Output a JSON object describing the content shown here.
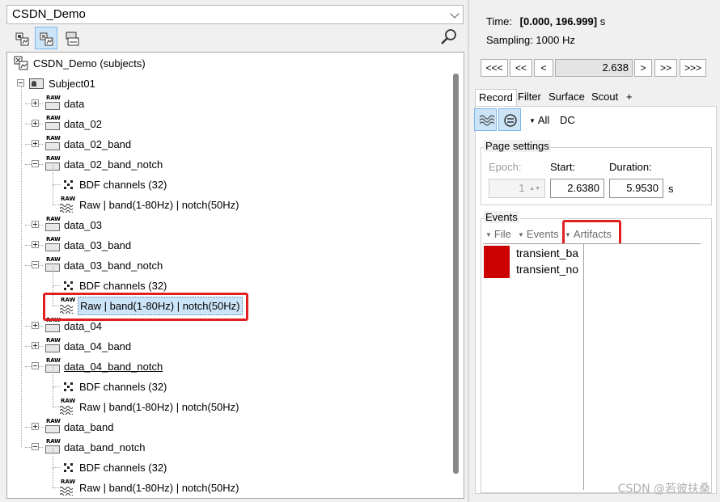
{
  "protocol": {
    "selected": "CSDN_Demo"
  },
  "toolbar": {
    "icons": [
      "view-functional-icon",
      "view-subjects-icon",
      "view-conditions-icon",
      "search-icon"
    ]
  },
  "tree": {
    "root": "CSDN_Demo (subjects)",
    "subject": "Subject01",
    "rows": [
      {
        "label": "data",
        "kind": "folder",
        "expanded": false
      },
      {
        "label": "data_02",
        "kind": "folder",
        "expanded": false
      },
      {
        "label": "data_02_band",
        "kind": "folder",
        "expanded": false
      },
      {
        "label": "data_02_band_notch",
        "kind": "folder",
        "expanded": true
      },
      {
        "label": "BDF channels (32)",
        "kind": "channels"
      },
      {
        "label": "Raw | band(1-80Hz) | notch(50Hz)",
        "kind": "raw"
      },
      {
        "label": "data_03",
        "kind": "folder",
        "expanded": false
      },
      {
        "label": "data_03_band",
        "kind": "folder",
        "expanded": false
      },
      {
        "label": "data_03_band_notch",
        "kind": "folder",
        "expanded": true
      },
      {
        "label": "BDF channels (32)",
        "kind": "channels"
      },
      {
        "label": "Raw | band(1-80Hz) | notch(50Hz)",
        "kind": "raw",
        "selected": true
      },
      {
        "label": "data_04",
        "kind": "folder",
        "expanded": false
      },
      {
        "label": "data_04_band",
        "kind": "folder",
        "expanded": false
      },
      {
        "label": "data_04_band_notch",
        "kind": "folder",
        "expanded": true,
        "underlined": true
      },
      {
        "label": "BDF channels (32)",
        "kind": "channels"
      },
      {
        "label": "Raw | band(1-80Hz) | notch(50Hz)",
        "kind": "raw"
      },
      {
        "label": "data_band",
        "kind": "folder",
        "expanded": false
      },
      {
        "label": "data_band_notch",
        "kind": "folder",
        "expanded": true
      },
      {
        "label": "BDF channels (32)",
        "kind": "channels"
      },
      {
        "label": "Raw | band(1-80Hz) | notch(50Hz)",
        "kind": "raw"
      }
    ]
  },
  "info": {
    "time_label": "Time:",
    "time_value": "[0.000, 196.999]",
    "time_unit": "s",
    "sampling": "Sampling: 1000 Hz"
  },
  "nav": {
    "buttons": [
      "<<<",
      "<<",
      "<",
      ">",
      ">>",
      ">>>"
    ],
    "current_time": "2.638"
  },
  "tabs": [
    "Record",
    "Filter",
    "Surface",
    "Scout",
    "+"
  ],
  "record": {
    "montage_all": "All",
    "montage_dc": "DC",
    "page_settings": {
      "title": "Page settings",
      "epoch_label": "Epoch:",
      "epoch_value": "1",
      "start_label": "Start:",
      "start_value": "2.6380",
      "duration_label": "Duration:",
      "duration_value": "5.9530",
      "unit": "s"
    },
    "events": {
      "title": "Events",
      "menus": [
        "File",
        "Events",
        "Artifacts"
      ],
      "items": [
        "transient_ba",
        "transient_no"
      ],
      "color": "#cc0000"
    }
  },
  "watermark": "CSDN @若彼扶桑",
  "colors": {
    "highlight_box": "#e02020",
    "selection": "#cce4f7"
  }
}
